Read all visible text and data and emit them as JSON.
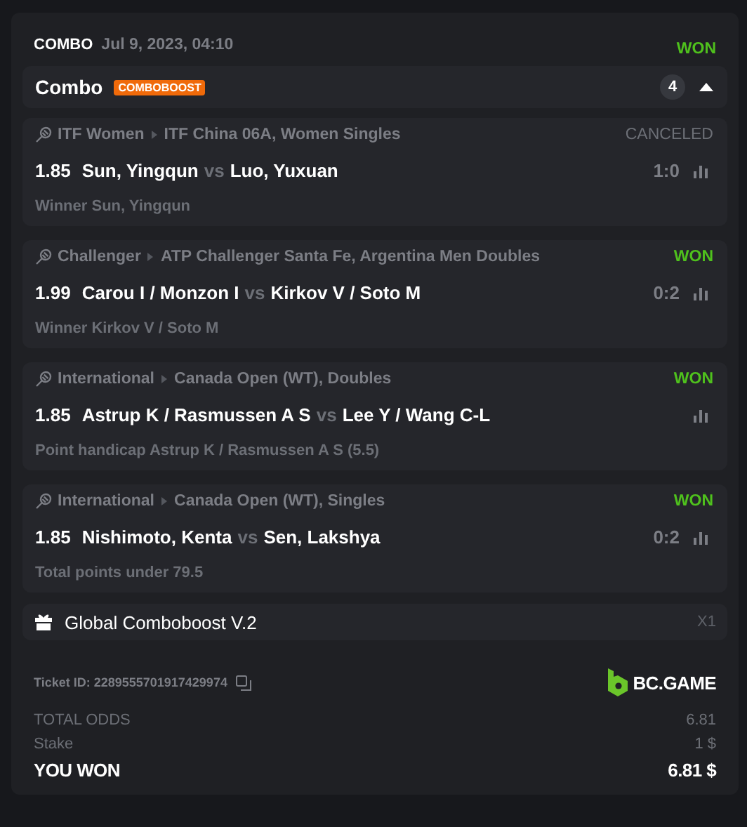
{
  "header": {
    "type": "COMBO",
    "date": "Jul 9, 2023, 04:10",
    "status": "WON",
    "kind": "won"
  },
  "combo_bar": {
    "title": "Combo",
    "badge": "COMBOBOOST",
    "count": "4",
    "expanded": true
  },
  "legs": [
    {
      "sport": "ITF Women",
      "tournament": "ITF China 06A, Women Singles",
      "status": "CANCELED",
      "kind": "canceled",
      "odds": "1.85",
      "home": "Sun, Yingqun",
      "vs": "vs",
      "away": "Luo, Yuxuan",
      "score": "1:0",
      "market": "Winner Sun, Yingqun"
    },
    {
      "sport": "Challenger",
      "tournament": "ATP Challenger Santa Fe, Argentina Men Doubles",
      "status": "WON",
      "kind": "won",
      "odds": "1.99",
      "home": "Carou I / Monzon I",
      "vs": "vs",
      "away": "Kirkov V / Soto M",
      "score": "0:2",
      "market": "Winner Kirkov V / Soto M"
    },
    {
      "sport": "International",
      "tournament": "Canada Open (WT), Doubles",
      "status": "WON",
      "kind": "won",
      "odds": "1.85",
      "home": "Astrup K / Rasmussen A S",
      "vs": "vs",
      "away": "Lee Y / Wang C-L",
      "market": "Point handicap Astrup K / Rasmussen A S (5.5)"
    },
    {
      "sport": "International",
      "tournament": "Canada Open (WT), Singles",
      "status": "WON",
      "kind": "won",
      "odds": "1.85",
      "home": "Nishimoto, Kenta",
      "vs": "vs",
      "away": "Sen, Lakshya",
      "score": "0:2",
      "market": "Total points under 79.5"
    }
  ],
  "boost": {
    "title": "Global Comboboost V.2",
    "multiplier": "X1"
  },
  "ticket": {
    "id": "Ticket ID: 2289555701917429974",
    "brand": "BC.GAME"
  },
  "totals": [
    {
      "label": "TOTAL ODDS",
      "value": "6.81",
      "kind": "muted"
    },
    {
      "label": "Stake",
      "value": "1 $",
      "kind": "muted"
    },
    {
      "label": "YOU WON",
      "value": "6.81 $",
      "kind": "result"
    }
  ]
}
